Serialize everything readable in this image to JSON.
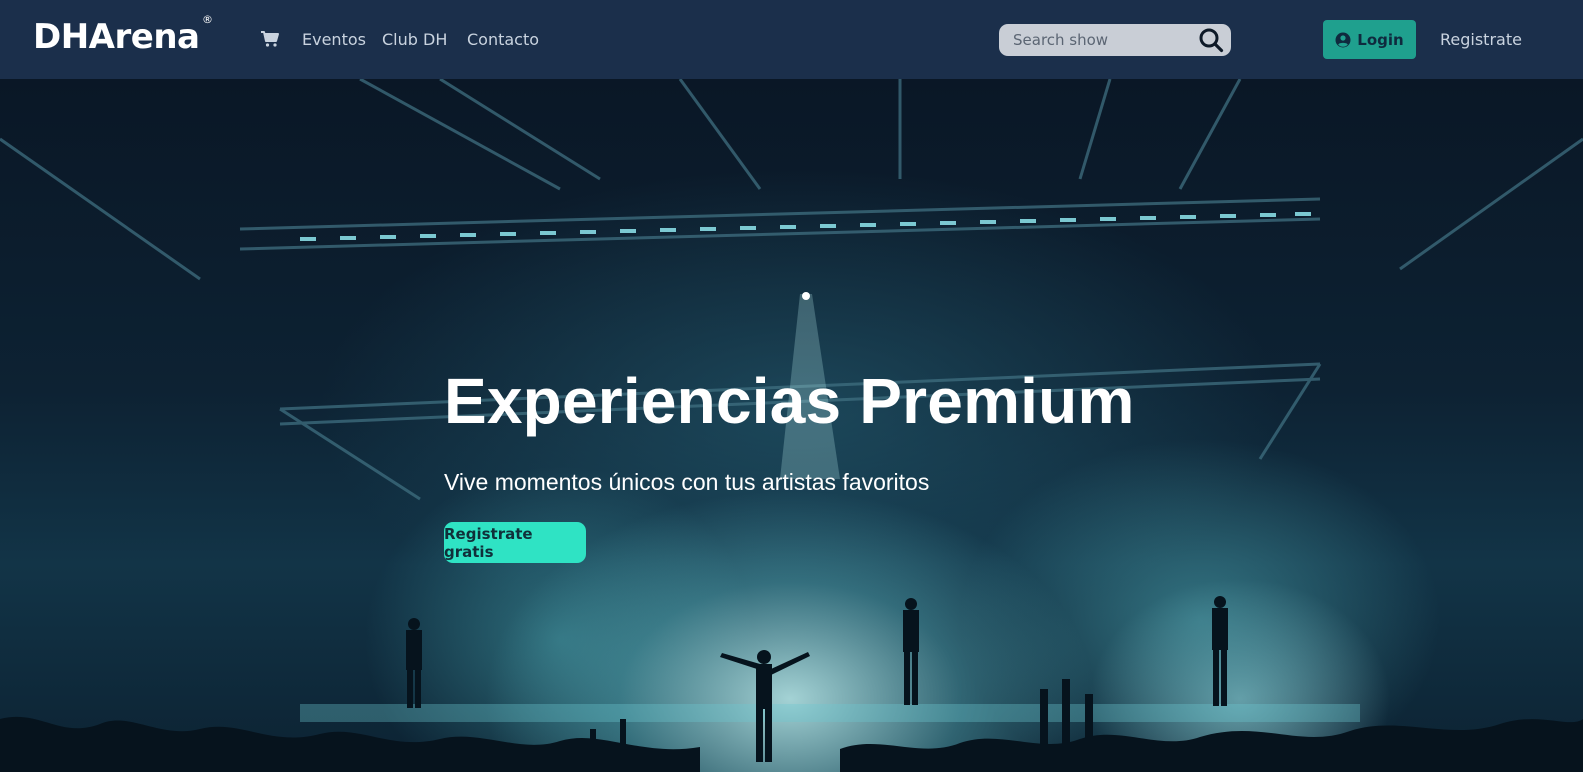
{
  "brand": {
    "name": "DHArena",
    "registered_mark": "®"
  },
  "nav": {
    "cart_icon": "shopping-cart-icon",
    "links": [
      "Eventos",
      "Club DH",
      "Contacto"
    ]
  },
  "search": {
    "placeholder": "Search show",
    "icon": "search-icon"
  },
  "auth": {
    "login_label": "Login",
    "login_icon": "user-circle-icon",
    "register_label": "Registrate"
  },
  "hero": {
    "title": "Experiencias Premium",
    "subtitle": "Vive momentos únicos con tus artistas favoritos",
    "cta_label": "Registrate gratis"
  },
  "colors": {
    "navbar_bg": "#1b2f4b",
    "login_bg": "#1fa08e",
    "cta_bg": "#2fe3c4",
    "search_bg": "#c9ced6"
  }
}
